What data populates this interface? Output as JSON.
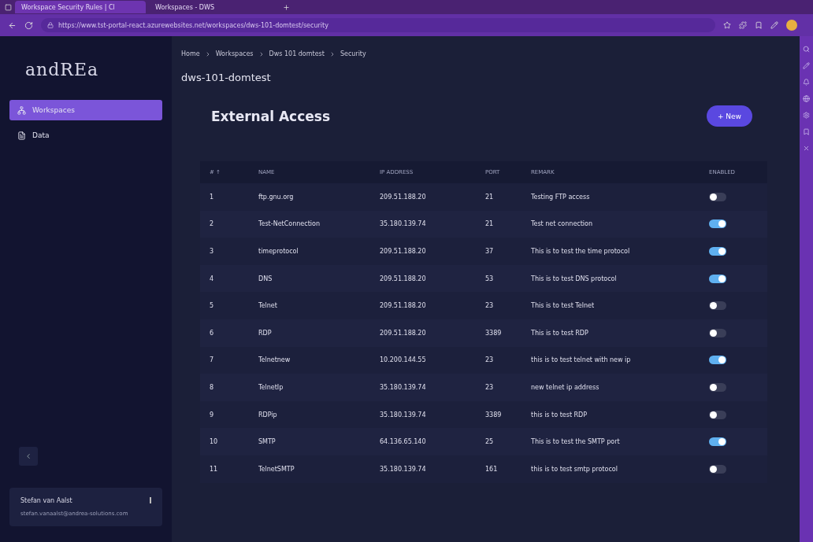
{
  "browser": {
    "tabs": [
      {
        "title": "Workspace Security Rules | Cl",
        "selected": true
      },
      {
        "title": "Workspaces - DWS",
        "selected": false
      }
    ],
    "url": "https://www.tst-portal-react.azurewebsites.net/workspaces/dws-101-domtest/security"
  },
  "sidebar": {
    "logo": "andREa",
    "items": [
      {
        "label": "Workspaces",
        "selected": true,
        "kind": "workspaces"
      },
      {
        "label": "Data",
        "selected": false,
        "kind": "data"
      }
    ],
    "user": {
      "name": "Stefan van Aalst",
      "email": "stefan.vanaalst@andrea-solutions.com"
    }
  },
  "breadcrumb": [
    "Home",
    "Workspaces",
    "Dws 101 domtest",
    "Security"
  ],
  "workspace_title": "dws-101-domtest",
  "section_title": "External Access",
  "new_button": "+ New",
  "table": {
    "columns": [
      "# ↑",
      "NAME",
      "IP ADDRESS",
      "PORT",
      "REMARK",
      "ENABLED"
    ],
    "rows": [
      {
        "cells": [
          "1",
          "ftp.gnu.org",
          "209.51.188.20",
          "21",
          "Testing FTP access"
        ],
        "enabled": false
      },
      {
        "cells": [
          "2",
          "Test-NetConnection",
          "35.180.139.74",
          "21",
          "Test net connection"
        ],
        "enabled": true
      },
      {
        "cells": [
          "3",
          "timeprotocol",
          "209.51.188.20",
          "37",
          "This is to test the time protocol"
        ],
        "enabled": true
      },
      {
        "cells": [
          "4",
          "DNS",
          "209.51.188.20",
          "53",
          "This is to test DNS protocol"
        ],
        "enabled": true
      },
      {
        "cells": [
          "5",
          "Telnet",
          "209.51.188.20",
          "23",
          "This is to test Telnet"
        ],
        "enabled": false
      },
      {
        "cells": [
          "6",
          "RDP",
          "209.51.188.20",
          "3389",
          "This is to test RDP"
        ],
        "enabled": false
      },
      {
        "cells": [
          "7",
          "Telnetnew",
          "10.200.144.55",
          "23",
          "this is to test telnet with new ip"
        ],
        "enabled": true
      },
      {
        "cells": [
          "8",
          "TelnetIp",
          "35.180.139.74",
          "23",
          "new telnet ip address"
        ],
        "enabled": false
      },
      {
        "cells": [
          "9",
          "RDPip",
          "35.180.139.74",
          "3389",
          "this is to test RDP"
        ],
        "enabled": false
      },
      {
        "cells": [
          "10",
          "SMTP",
          "64.136.65.140",
          "25",
          "This is to test the SMTP port"
        ],
        "enabled": true
      },
      {
        "cells": [
          "11",
          "TelnetSMTP",
          "35.180.139.74",
          "161",
          "this is to test smtp protocol"
        ],
        "enabled": false
      }
    ]
  }
}
